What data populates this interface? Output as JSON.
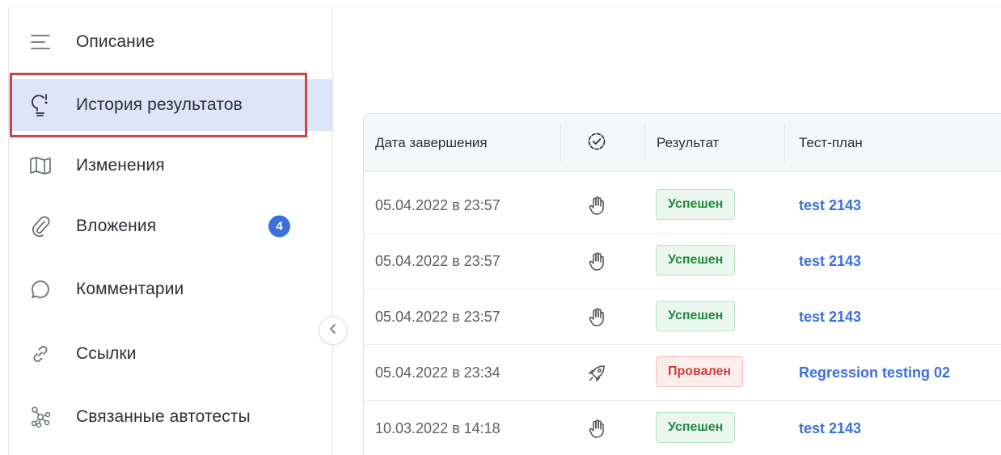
{
  "sidebar": {
    "items": [
      {
        "label": "Описание",
        "icon": "menu-lines-icon"
      },
      {
        "label": "История результатов",
        "icon": "lightbulb-icon",
        "active": true
      },
      {
        "label": "Изменения",
        "icon": "map-icon"
      },
      {
        "label": "Вложения",
        "icon": "paperclip-icon",
        "badge": "4"
      },
      {
        "label": "Комментарии",
        "icon": "comment-icon"
      },
      {
        "label": "Ссылки",
        "icon": "link-icon"
      },
      {
        "label": "Связанные автотесты",
        "icon": "network-icon"
      }
    ],
    "collapse_icon": "chevron-left-icon"
  },
  "table": {
    "headers": {
      "date": "Дата завершения",
      "type_icon": "check-circle-dashed-icon",
      "result": "Результат",
      "plan": "Тест-план"
    },
    "rows": [
      {
        "date": "05.04.2022 в 23:57",
        "type_icon": "hand-icon",
        "status": "Успешен",
        "status_kind": "success",
        "plan": "test 2143"
      },
      {
        "date": "05.04.2022 в 23:57",
        "type_icon": "hand-icon",
        "status": "Успешен",
        "status_kind": "success",
        "plan": "test 2143"
      },
      {
        "date": "05.04.2022 в 23:57",
        "type_icon": "hand-icon",
        "status": "Успешен",
        "status_kind": "success",
        "plan": "test 2143"
      },
      {
        "date": "05.04.2022 в 23:34",
        "type_icon": "rocket-icon",
        "status": "Провален",
        "status_kind": "failure",
        "plan": "Regression testing 02"
      },
      {
        "date": "10.03.2022 в 14:18",
        "type_icon": "hand-icon",
        "status": "Успешен",
        "status_kind": "success",
        "plan": "test 2143"
      }
    ]
  },
  "colors": {
    "accent": "#3b6fe0",
    "active_bg": "#dde6f8",
    "highlight_outline": "#d0433c",
    "success_text": "#1f8a3d",
    "failure_text": "#d23a3a"
  }
}
